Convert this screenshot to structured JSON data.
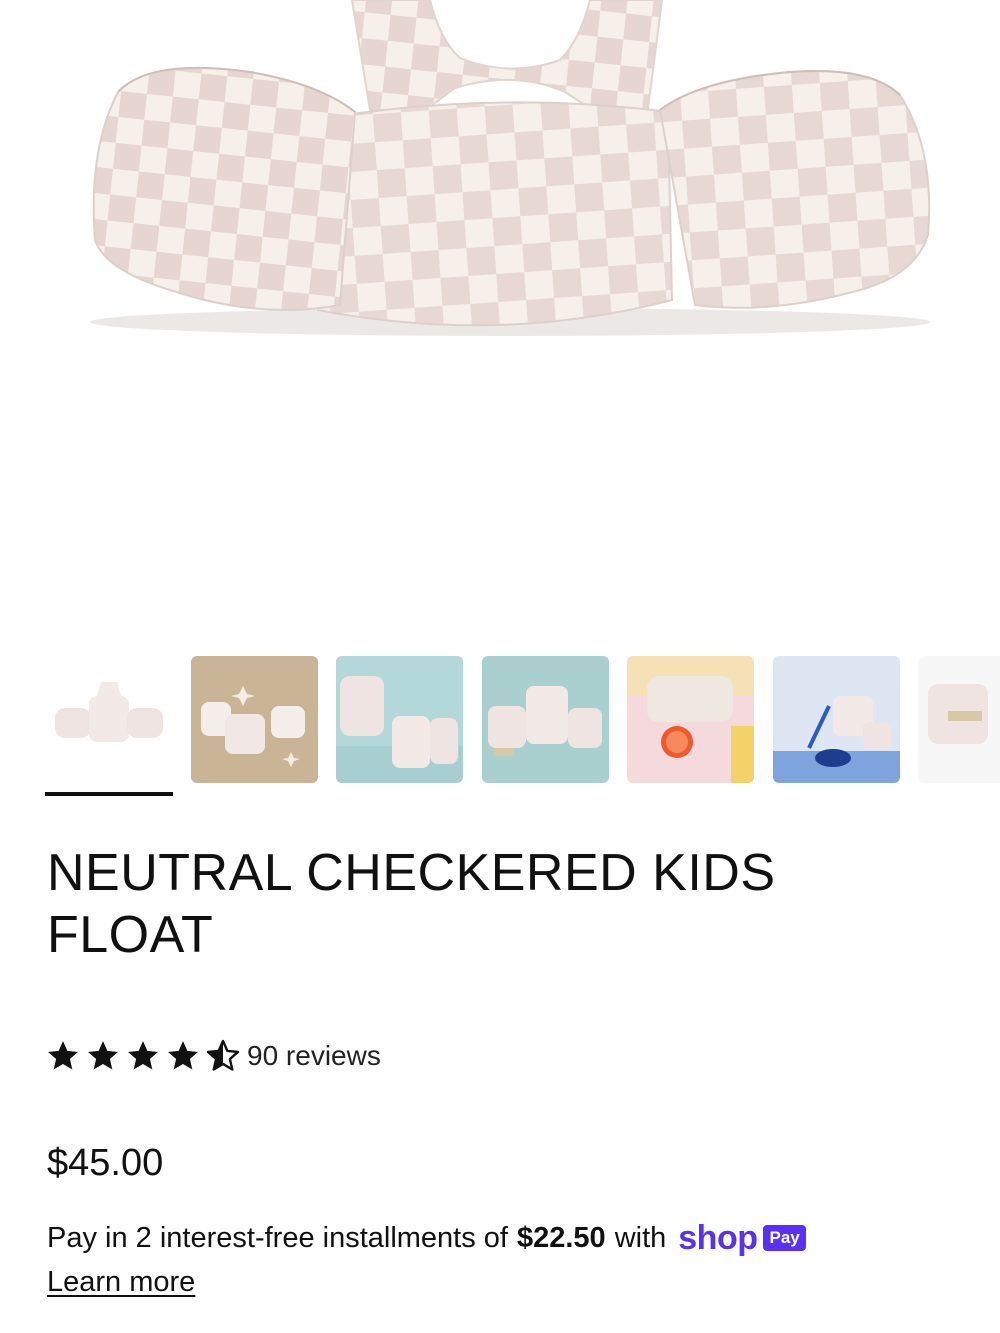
{
  "product": {
    "title": "NEUTRAL CHECKERED KIDS FLOAT",
    "rating": 4.5,
    "rating_max": 5,
    "reviews_label": "90 reviews",
    "price": "$45.00"
  },
  "payment": {
    "prefix": "Pay in 2 interest-free installments of",
    "amount": "$22.50",
    "suffix": "with",
    "brand": "shop",
    "badge": "Pay",
    "learn_more": "Learn more"
  },
  "gallery": {
    "selected_index": 0,
    "thumbnails": [
      {
        "icon": "float-white-bg"
      },
      {
        "icon": "float-on-sand"
      },
      {
        "icon": "float-on-teal"
      },
      {
        "icon": "float-on-teal-2"
      },
      {
        "icon": "float-with-grapefruit"
      },
      {
        "icon": "float-with-snorkel"
      },
      {
        "icon": "float-side-view"
      }
    ]
  },
  "colors": {
    "accent": "#5a31f4",
    "check_light": "#f6efea",
    "check_dark": "#e7d6d3"
  }
}
